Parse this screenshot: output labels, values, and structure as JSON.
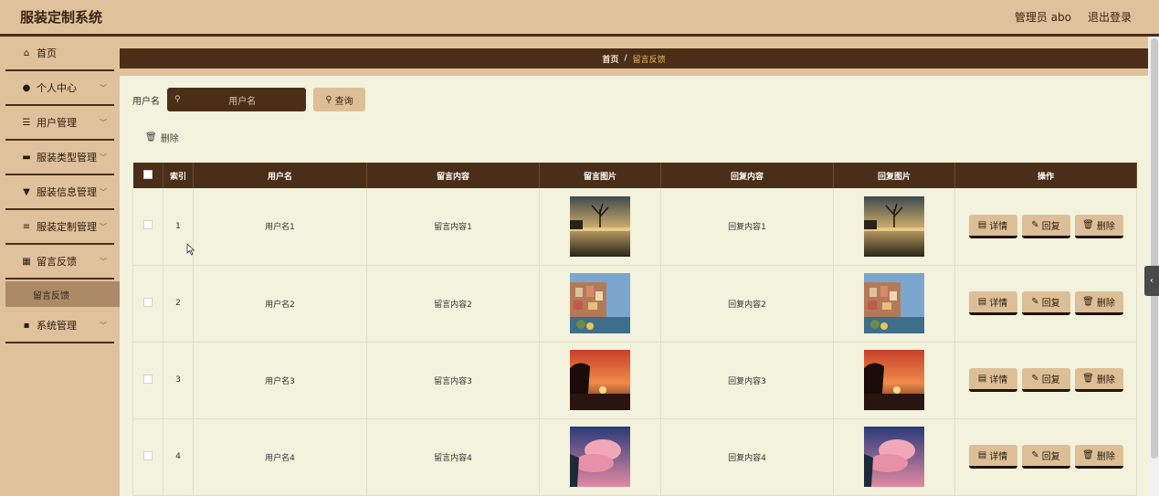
{
  "header": {
    "brand": "服装定制系统",
    "user": "管理员 abo",
    "logout": "退出登录"
  },
  "sidebar": {
    "items": [
      {
        "icon": "⌂",
        "icon_name": "home-icon",
        "label": "首页",
        "expandable": false
      },
      {
        "icon": "●",
        "icon_name": "person-icon",
        "label": "个人中心",
        "expandable": true
      },
      {
        "icon": "☰",
        "icon_name": "sliders-icon",
        "label": "用户管理",
        "expandable": true
      },
      {
        "icon": "▬",
        "icon_name": "briefcase-icon",
        "label": "服装类型管理",
        "expandable": true
      },
      {
        "icon": "▼",
        "icon_name": "funnel-icon",
        "label": "服装信息管理",
        "expandable": true
      },
      {
        "icon": "≡",
        "icon_name": "list-icon",
        "label": "服装定制管理",
        "expandable": true
      },
      {
        "icon": "▦",
        "icon_name": "grid-icon",
        "label": "留言反馈",
        "expandable": true
      },
      {
        "icon": "▪",
        "icon_name": "apps-icon",
        "label": "系统管理",
        "expandable": true
      }
    ],
    "subitem": "留言反馈"
  },
  "breadcrumb": {
    "home": "首页",
    "sep": "/",
    "current": "留言反馈"
  },
  "search": {
    "label": "用户名",
    "placeholder": "用户名",
    "button": "查询"
  },
  "delete_label": "删除",
  "table": {
    "headers": [
      "索引",
      "用户名",
      "留言内容",
      "留言图片",
      "回复内容",
      "回复图片",
      "操作"
    ],
    "rows": [
      {
        "index": "1",
        "user": "用户名1",
        "content": "留言内容1",
        "reply": "回复内容1",
        "image": "lake-tree"
      },
      {
        "index": "2",
        "user": "用户名2",
        "content": "留言内容2",
        "reply": "回复内容2",
        "image": "coastal-town"
      },
      {
        "index": "3",
        "user": "用户名3",
        "content": "留言内容3",
        "reply": "回复内容3",
        "image": "sunset"
      },
      {
        "index": "4",
        "user": "用户名4",
        "content": "留言内容4",
        "reply": "回复内容4",
        "image": "pink-clouds"
      }
    ],
    "ops": {
      "detail": "详情",
      "reply": "回复",
      "delete": "删除"
    }
  },
  "colors": {
    "dark_brown": "#4b2e17",
    "tan": "#dfc19b",
    "cream": "#f3f2dc",
    "accent": "#e8b862"
  }
}
